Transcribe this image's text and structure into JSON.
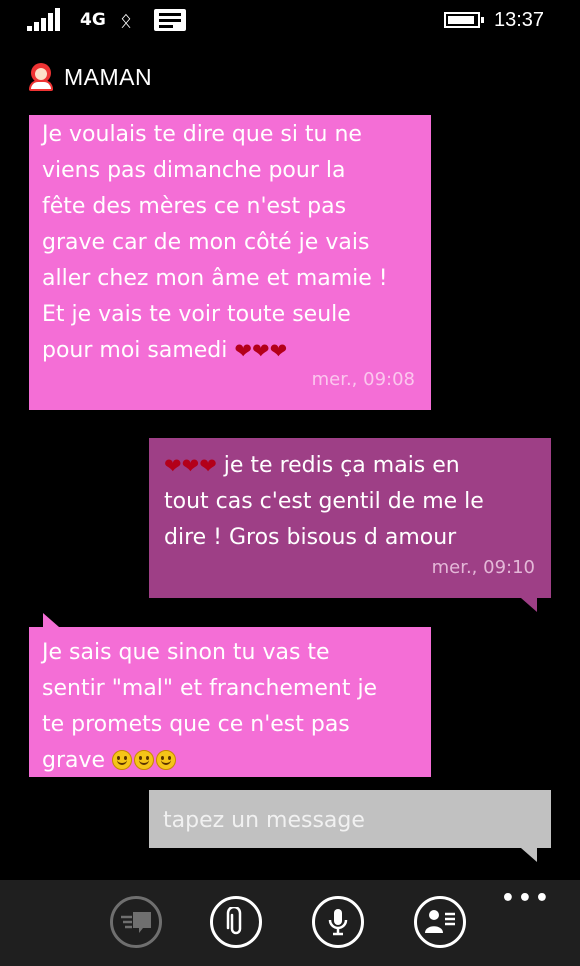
{
  "status_bar": {
    "network": "4G",
    "time": "13:37"
  },
  "contact": {
    "name": "MAMAN"
  },
  "messages": [
    {
      "direction": "incoming",
      "text": "Je voulais te dire que si tu ne\nviens pas dimanche pour la\nfête des mères ce n'est pas\ngrave car de mon côté je vais\naller chez mon âme et mamie !\nEt je vais te voir toute seule\npour moi samedi ",
      "emoji": "❤❤❤",
      "time": "mer., 09:08"
    },
    {
      "direction": "outgoing",
      "emoji": "❤❤❤",
      "text": "  je te redis ça mais en\ntout cas c'est gentil de me le\ndire ! Gros bisous d amour",
      "time": "mer., 09:10"
    },
    {
      "direction": "incoming",
      "text": "Je sais que sinon tu vas te\nsentir \"mal\" et franchement je\nte promets que ce n'est pas\ngrave ",
      "emoji_count": 3
    }
  ],
  "compose": {
    "placeholder": "tapez un message"
  },
  "app_bar": {
    "buttons": [
      "switch-chat-icon",
      "attach-icon",
      "microphone-icon",
      "contact-card-icon"
    ],
    "more": "•••"
  },
  "colors": {
    "incoming": "#f46ed6",
    "outgoing": "#9e3f86",
    "compose": "#c1c1c1",
    "heart": "#b3001a"
  }
}
